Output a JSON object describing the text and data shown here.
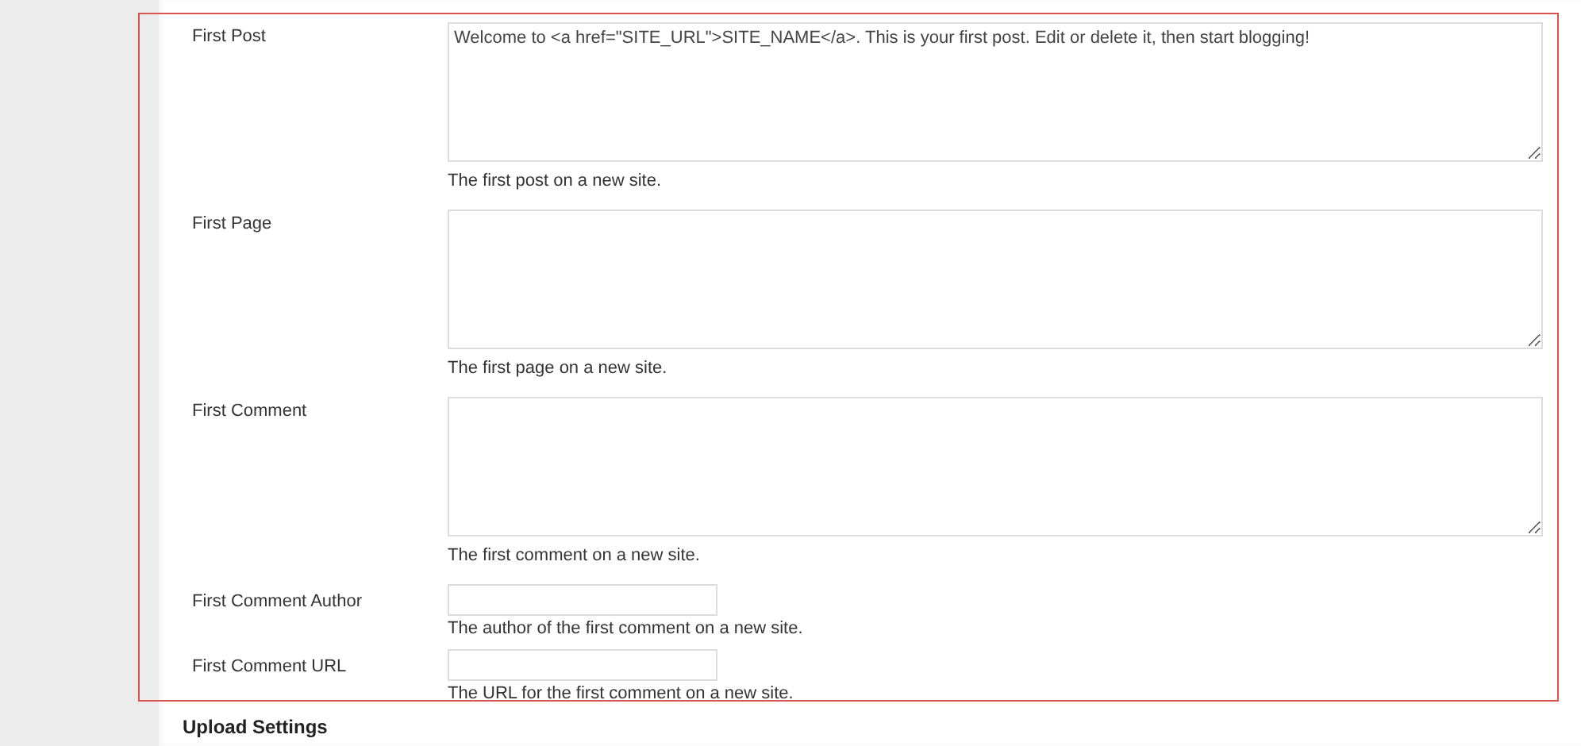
{
  "fields": [
    {
      "kind": "textarea",
      "label": "First Post",
      "value": "Welcome to <a href=\"SITE_URL\">SITE_NAME</a>. This is your first post. Edit or delete it, then start blogging!",
      "description": "The first post on a new site."
    },
    {
      "kind": "textarea",
      "label": "First Page",
      "description": "The first page on a new site."
    },
    {
      "kind": "textarea",
      "label": "First Comment",
      "description": "The first comment on a new site."
    },
    {
      "kind": "input",
      "label": "First Comment Author",
      "description": "The author of the first comment on a new site."
    },
    {
      "kind": "input",
      "label": "First Comment URL",
      "description": "The URL for the first comment on a new site."
    }
  ],
  "next_section": {
    "heading": "Upload Settings"
  }
}
